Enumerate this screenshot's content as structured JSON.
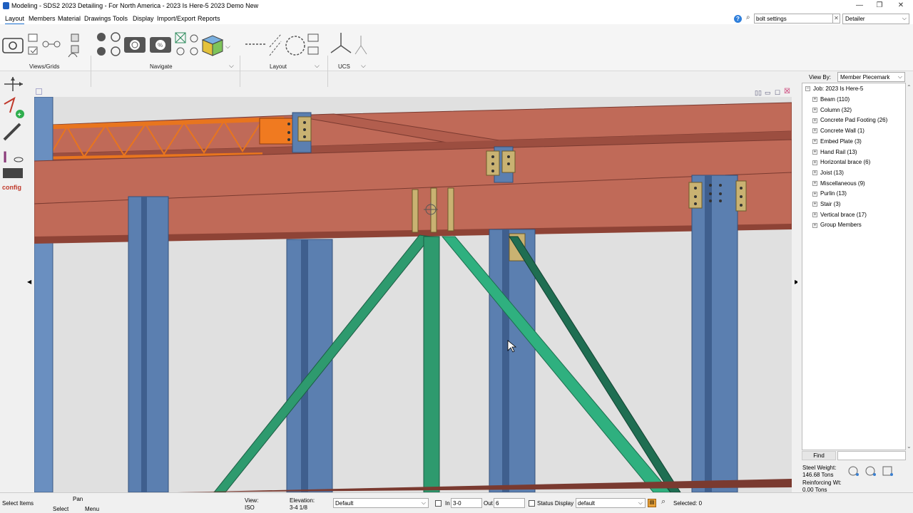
{
  "window": {
    "title": "Modeling - SDS2 2023 Detailing - For North America - 2023 Is Here-5 2023 Demo New",
    "minimize": "—",
    "restore": "❐",
    "close": "✕"
  },
  "menu": {
    "items": [
      "Layout",
      "Members",
      "Material",
      "Drawings",
      "Tools",
      "Display",
      "Import/Export",
      "Reports"
    ]
  },
  "search": {
    "value": "bolt settings",
    "clear": "✕"
  },
  "role": {
    "selected": "Detailer"
  },
  "ribbon": {
    "groups": [
      "Views/Grids",
      "Navigate",
      "Layout",
      "UCS"
    ]
  },
  "right_panel": {
    "view_by_label": "View By:",
    "view_by_value": "Member Piecemark",
    "tree": {
      "root": "Job: 2023 Is Here-5",
      "items": [
        "Beam (110)",
        "Column (32)",
        "Concrete Pad Footing (26)",
        "Concrete Wall (1)",
        "Embed Plate (3)",
        "Hand Rail (13)",
        "Horizontal brace (6)",
        "Joist (13)",
        "Miscellaneous (9)",
        "Purlin (13)",
        "Stair (3)",
        "Vertical brace (17)",
        "Group Members"
      ]
    },
    "find_label": "Find",
    "steel_weight_label": "Steel Weight:",
    "steel_weight_value": "146.68 Tons",
    "reinforcing_label": "Reinforcing Wt:",
    "reinforcing_value": "0.00 Tons"
  },
  "status": {
    "mode": "Select Items",
    "pan_label": "Pan",
    "select_label": "Select",
    "menu_label": "Menu",
    "view_label": "View:",
    "view_value": "ISO",
    "elevation_label": "Elevation:",
    "elevation_value": "3-4 1/8",
    "preset_value": "Default",
    "in_label": "In",
    "in_value": "3-0",
    "out_label": "Out",
    "out_value": "6",
    "status_display_label": "Status Display",
    "display_value": "default",
    "selected_text": "Selected: 0"
  },
  "colors": {
    "beam": "#c06a58",
    "column": "#5b7fb0",
    "brace_light": "#2aa378",
    "brace_dark": "#1f6e52",
    "joist": "#e8751e",
    "plate": "#c9b272",
    "accent": "#1a6fd0"
  }
}
